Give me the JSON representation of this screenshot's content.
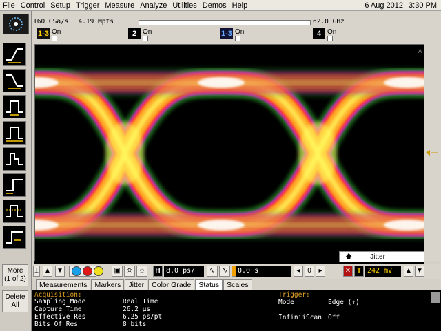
{
  "menu": {
    "items": [
      "File",
      "Control",
      "Setup",
      "Trigger",
      "Measure",
      "Analyze",
      "Utilities",
      "Demos",
      "Help"
    ],
    "date": "6 Aug 2012",
    "time": "3:30 PM"
  },
  "acquisition_header": {
    "sample_rate": "160 GSa/s",
    "memory": "4.19 Mpts",
    "bandwidth": "62.0 GHz"
  },
  "channels": [
    {
      "label": "1-3",
      "state": "On"
    },
    {
      "label": "2",
      "state": "On"
    },
    {
      "label": "1-3",
      "state": "On"
    },
    {
      "label": "4",
      "state": "On"
    }
  ],
  "sidebar": {
    "more_label": "More",
    "more_page": "(1 of 2)",
    "delete_label": "Delete",
    "delete_all_label": "All"
  },
  "controls": {
    "timebase_label": "H",
    "timebase_value": "8.0 ps/",
    "delay_value": "0.0 s",
    "trigger_level": "242 mV",
    "trigger_label": "T",
    "jitter_tab": "Jitter"
  },
  "tabs": [
    "Measurements",
    "Markers",
    "Jitter",
    "Color Grade",
    "Status",
    "Scales"
  ],
  "active_tab": "Status",
  "status": {
    "acquisition_title": "Acquisition:",
    "acquisition_rows": [
      {
        "key": "Sampling Mode",
        "value": "Real Time"
      },
      {
        "key": "Capture Time",
        "value": "26.2 µs"
      },
      {
        "key": "Effective Res",
        "value": "6.25 ps/pt"
      },
      {
        "key": "Bits Of Res",
        "value": "8 bits"
      }
    ],
    "trigger_title": "Trigger:",
    "trigger_rows": [
      {
        "key": "Mode",
        "value": "Edge (↑)"
      },
      {
        "key": "InfiniiScan",
        "value": "Off"
      }
    ]
  },
  "colors": {
    "eye_outer": "#30c030",
    "eye_mid": "#e020e0",
    "eye_inner": "#ff3030",
    "eye_core": "#ffa020",
    "eye_hot": "#ffff60"
  }
}
